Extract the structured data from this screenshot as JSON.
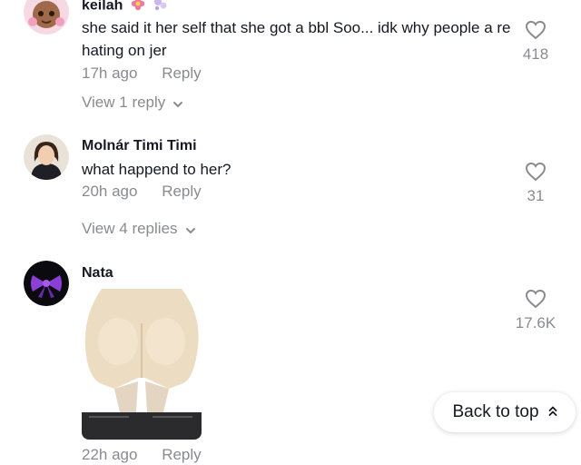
{
  "comments": [
    {
      "username": "keilah",
      "text": "she said it her self that she got a bbl Soo... idk why people a re hating on jer",
      "time": "17h ago",
      "reply_label": "Reply",
      "likes": "418",
      "view_replies": "View 1 reply"
    },
    {
      "username": "Molnár Timi Timi",
      "text": "what happend to her?",
      "time": "20h ago",
      "reply_label": "Reply",
      "likes": "31",
      "view_replies": "View 4 replies"
    },
    {
      "username": "Nata",
      "time": "22h ago",
      "reply_label": "Reply",
      "likes": "17.6K"
    }
  ],
  "back_to_top": "Back to top",
  "icons": {
    "like": "heart-outline-icon",
    "expand": "chevron-down-icon",
    "scroll_top": "double-chevron-up-icon"
  },
  "colors": {
    "primary_text": "#161823",
    "secondary_text": "#8a8b91"
  }
}
